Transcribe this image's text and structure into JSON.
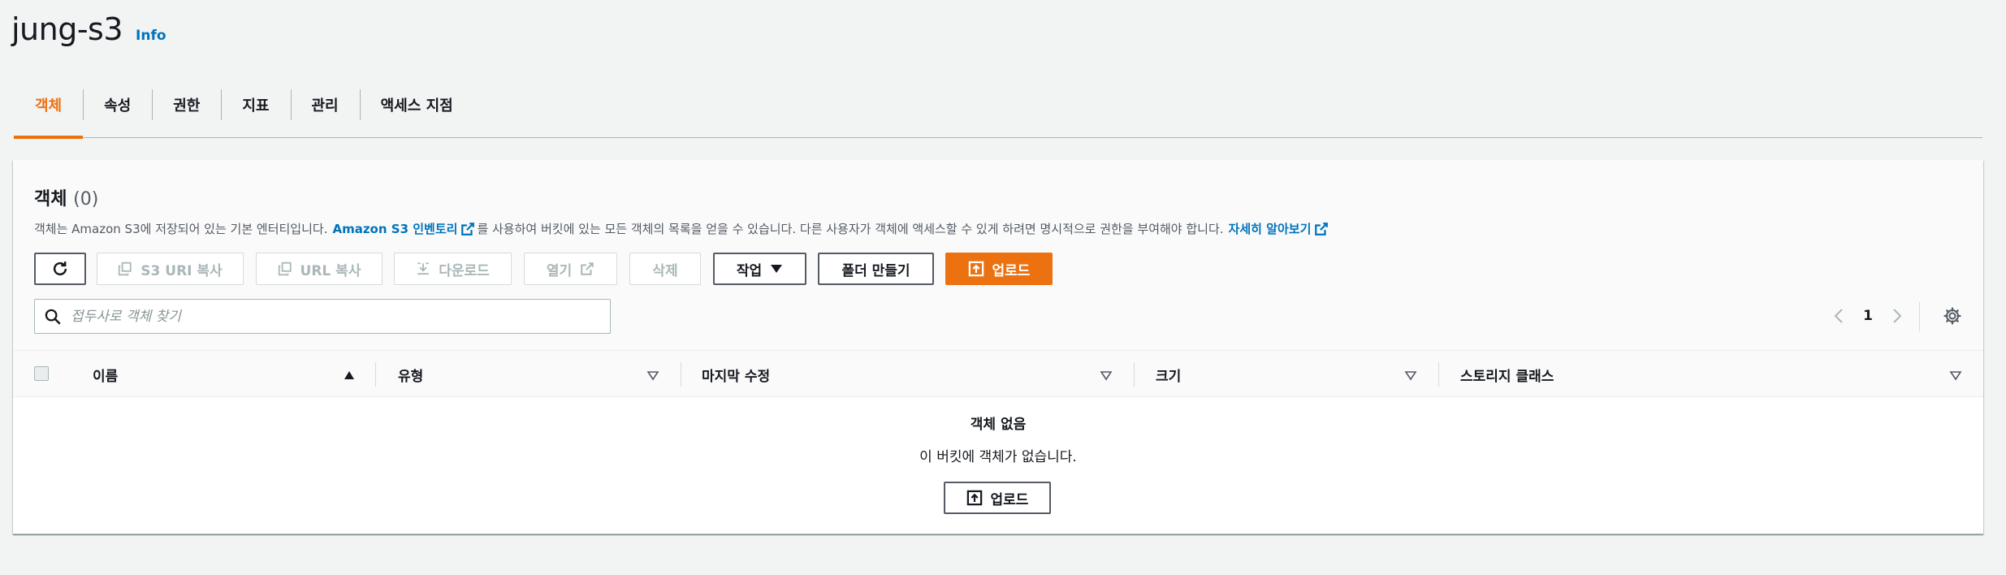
{
  "page": {
    "title": "jung-s3",
    "info_link": "Info"
  },
  "tabs": [
    {
      "label": "객체",
      "active": true
    },
    {
      "label": "속성"
    },
    {
      "label": "권한"
    },
    {
      "label": "지표"
    },
    {
      "label": "관리"
    },
    {
      "label": "액세스 지점"
    }
  ],
  "objects": {
    "heading": "객체",
    "count": "(0)",
    "desc_before": "객체는 Amazon S3에 저장되어 있는 기본 엔터티입니다.",
    "desc_link1": "Amazon S3 인벤토리",
    "desc_middle": "를 사용하여 버킷에 있는 모든 객체의 목록을 얻을 수 있습니다. 다른 사용자가 객체에 액세스할 수 있게 하려면 명시적으로 권한을 부여해야 합니다.",
    "desc_link2": "자세히 알아보기"
  },
  "toolbar": {
    "refresh_icon": "refresh-icon",
    "copy_s3_uri": "S3 URI 복사",
    "copy_url": "URL 복사",
    "download": "다운로드",
    "open": "열기",
    "delete": "삭제",
    "actions": "작업",
    "create_folder": "폴더 만들기",
    "upload": "업로드"
  },
  "search": {
    "placeholder": "접두사로 객체 찾기"
  },
  "pagination": {
    "current_page": "1"
  },
  "table": {
    "columns": [
      {
        "label": "이름",
        "sort": "ascending"
      },
      {
        "label": "유형",
        "sort": "none"
      },
      {
        "label": "마지막 수정",
        "sort": "none"
      },
      {
        "label": "크기",
        "sort": "none"
      },
      {
        "label": "스토리지 클래스",
        "sort": "none"
      }
    ],
    "rows": []
  },
  "empty_state": {
    "title": "객체 없음",
    "description": "이 버킷에 객체가 없습니다.",
    "upload_button": "업로드"
  },
  "colors": {
    "accent": "#ec7211",
    "link": "#0073bb",
    "text": "#16191f",
    "background": "#f2f3f3"
  }
}
